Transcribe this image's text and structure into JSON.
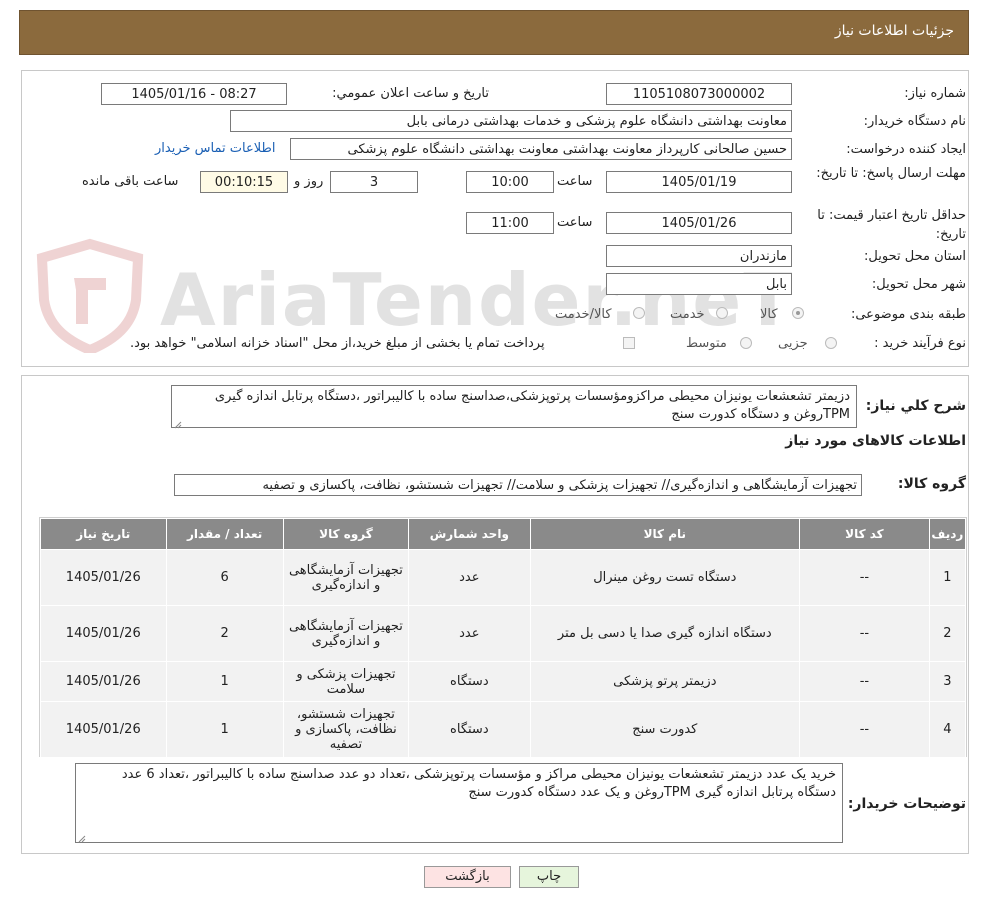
{
  "header": {
    "title": "جزئیات اطلاعات نیاز"
  },
  "watermark": {
    "text": "AriaTender.neT"
  },
  "form": {
    "need_number_label": "شماره نیاز:",
    "need_number": "1105108073000002",
    "announce_label": "تاریخ و ساعت اعلان عمومي:",
    "announce_value": "1405/01/16 - 08:27",
    "buyer_label": "نام دستگاه خریدار:",
    "buyer_value": "معاونت بهداشتی دانشگاه علوم پزشکی و خدمات بهداشتی درمانی بابل",
    "creator_label": "ایجاد کننده درخواست:",
    "creator_value": "حسین صالحانی کارپرداز معاونت بهداشتی معاونت بهداشتی دانشگاه علوم پزشکی",
    "contact_link": "اطلاعات تماس خریدار",
    "deadline_label": "مهلت ارسال پاسخ: تا تاریخ:",
    "deadline_date": "1405/01/19",
    "time_label": "ساعت",
    "deadline_time": "10:00",
    "days_value": "3",
    "days_label": "روز و",
    "remaining_value": "00:10:15",
    "remaining_label": "ساعت باقی مانده",
    "validity_label": "حداقل تاریخ اعتبار قیمت: تا تاریخ:",
    "validity_date": "1405/01/26",
    "validity_time": "11:00",
    "province_label": "استان محل تحویل:",
    "province_value": "مازندران",
    "city_label": "شهر محل تحویل:",
    "city_value": "بابل",
    "category_label": "طبقه بندی موضوعی:",
    "category_options": [
      "کالا",
      "خدمت",
      "کالا/خدمت"
    ],
    "category_selected": "کالا",
    "process_label": "نوع فرآیند خرید :",
    "process_options": [
      "جزیی",
      "متوسط"
    ],
    "payment_text": "پرداخت تمام یا بخشی از مبلغ خرید،از محل \"اسناد خزانه اسلامی\" خواهد بود."
  },
  "summary": {
    "label": "شرح کلي نياز:",
    "text": "دزیمتر تشعشعات یونیزان محیطی مراکزومؤسسات پرتوپزشکی،صداسنج ساده با کالیبراتور ،دستگاه پرتابل اندازه گیری TPMروغن و  دستگاه کدورت سنج"
  },
  "goods_section": {
    "title": "اطلاعات کالاهای مورد نیاز",
    "group_label": "گروه کالا:",
    "group_value": "تجهیزات آزمایشگاهی و اندازه‌گیری// تجهیزات پزشکی و سلامت// تجهیزات شستشو، نظافت، پاکسازی و تصفیه"
  },
  "table": {
    "headers": [
      "ردیف",
      "کد کالا",
      "نام کالا",
      "واحد شمارش",
      "گروه کالا",
      "تعداد / مقدار",
      "تاریخ نیاز"
    ],
    "rows": [
      {
        "index": "1",
        "code": "--",
        "name": "دستگاه تست روغن مینرال",
        "unit": "عدد",
        "group": "تجهیزات آزمایشگاهی و اندازه‌گیری",
        "qty": "6",
        "date": "1405/01/26"
      },
      {
        "index": "2",
        "code": "--",
        "name": "دستگاه اندازه گیری صدا یا دسی بل متر",
        "unit": "عدد",
        "group": "تجهیزات آزمایشگاهی و اندازه‌گیری",
        "qty": "2",
        "date": "1405/01/26"
      },
      {
        "index": "3",
        "code": "--",
        "name": "دزیمتر پرتو پزشکی",
        "unit": "دستگاه",
        "group": "تجهیزات پزشکی و سلامت",
        "qty": "1",
        "date": "1405/01/26"
      },
      {
        "index": "4",
        "code": "--",
        "name": "کدورت سنج",
        "unit": "دستگاه",
        "group": "تجهیزات شستشو، نظافت، پاکسازی و تصفیه",
        "qty": "1",
        "date": "1405/01/26"
      }
    ]
  },
  "buyer_notes": {
    "label": "توضیحات خریدار:",
    "text": "خرید یک عدد دزیمتر تشعشعات یونیزان محیطی مراکز و مؤسسات پرتوپزشکی ،تعداد دو عدد صداسنج ساده با کالیبراتور ،تعداد 6 عدد دستگاه پرتابل اندازه گیری TPMروغن و یک عدد دستگاه کدورت سنج"
  },
  "buttons": {
    "print": "چاپ",
    "back": "بازگشت"
  }
}
